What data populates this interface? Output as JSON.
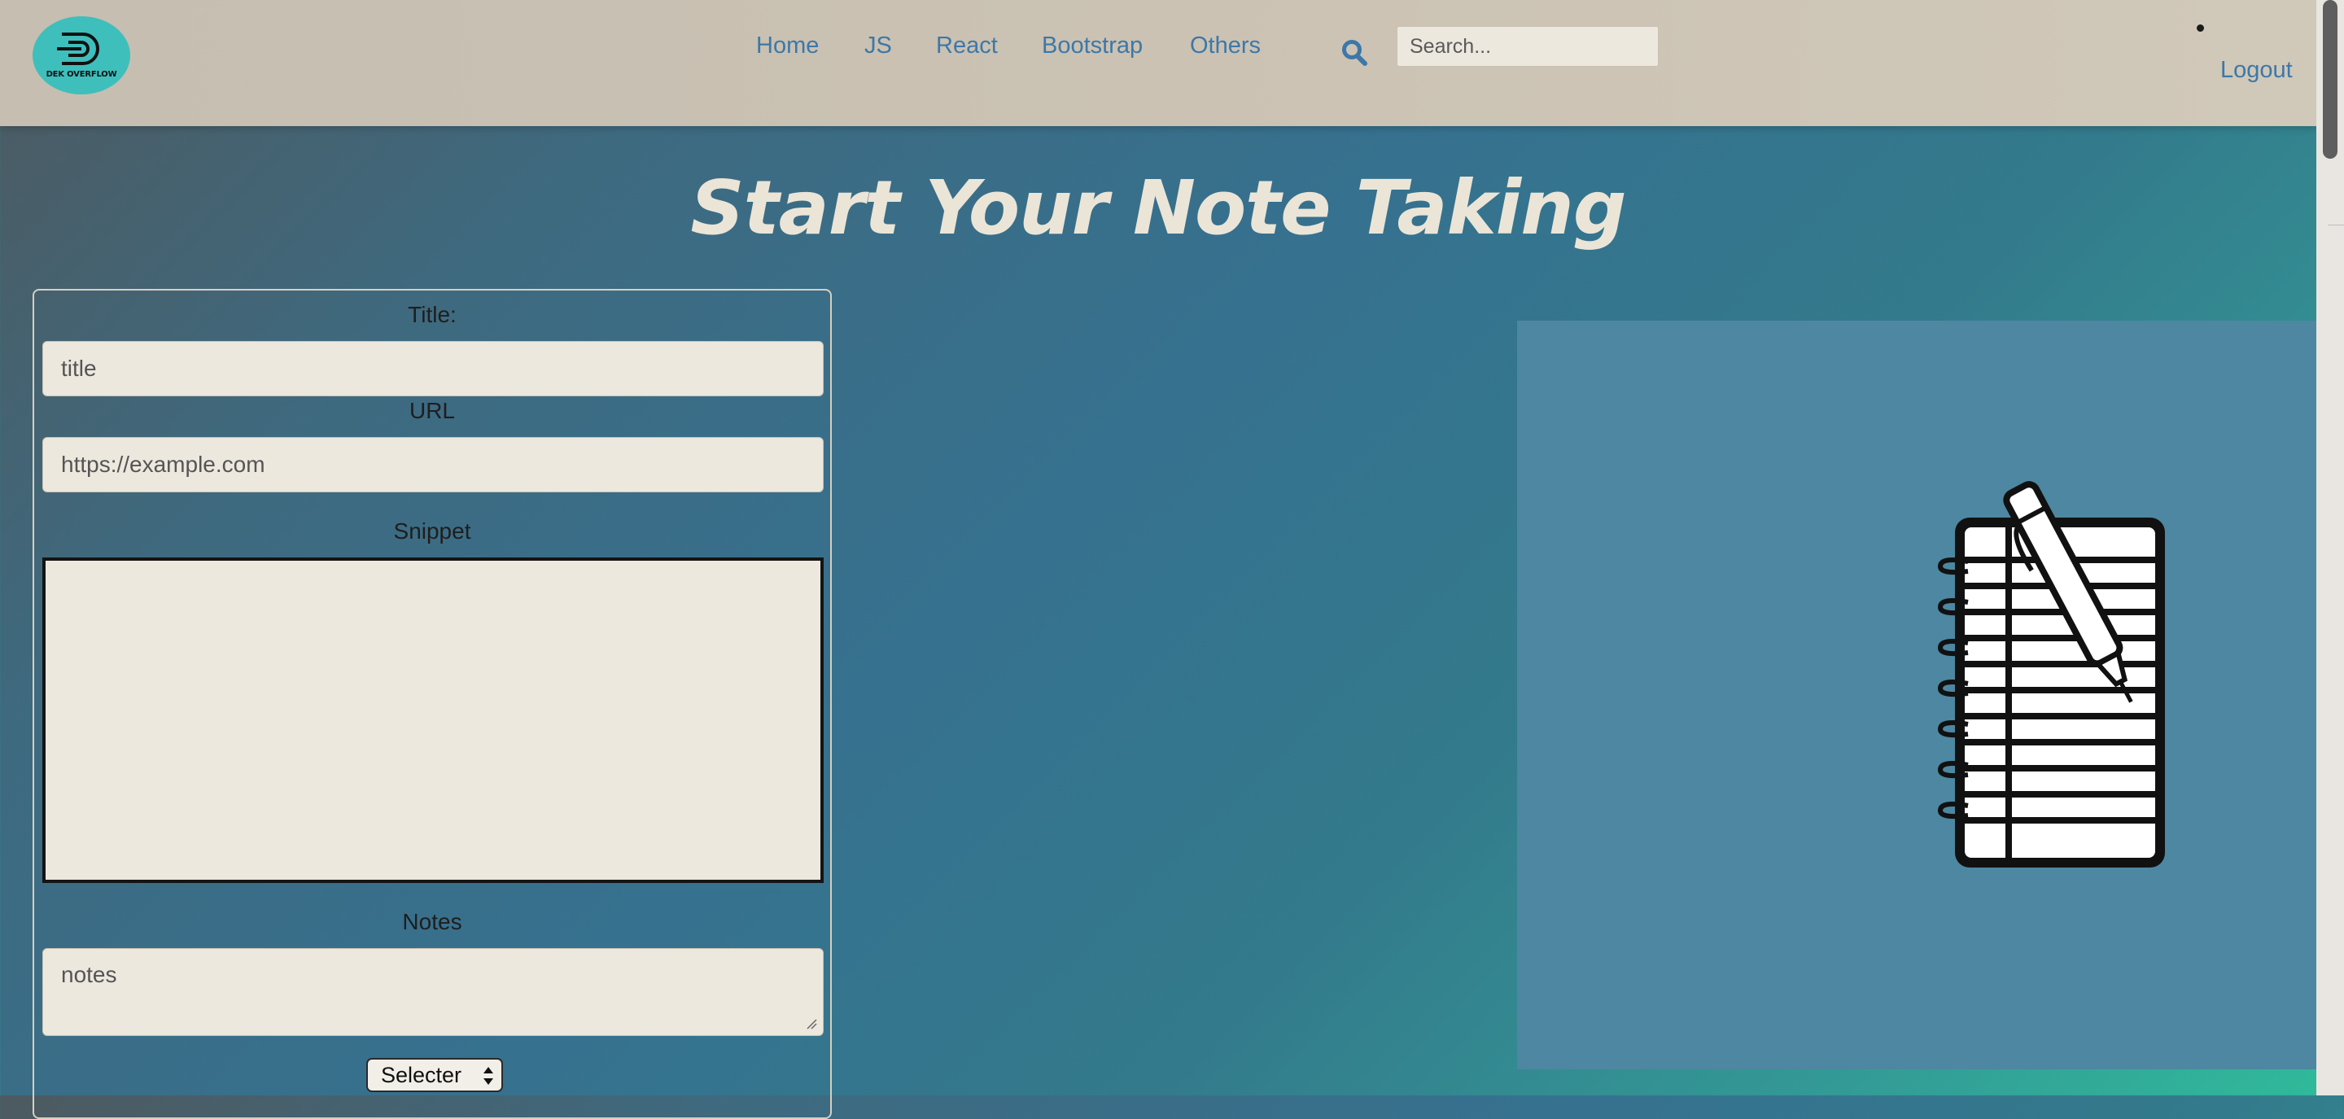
{
  "navbar": {
    "logo_text": "DEK OVERFLOW",
    "links": [
      "Home",
      "JS",
      "React",
      "Bootstrap",
      "Others"
    ],
    "search_placeholder": "Search...",
    "logout": "Logout",
    "link_color": "#3d78a8"
  },
  "hero": {
    "title": "Start Your Note Taking"
  },
  "form": {
    "title_label": "Title:",
    "title_placeholder": "title",
    "url_label": "URL",
    "url_placeholder": "https://example.com",
    "snippet_label": "Snippet",
    "notes_label": "Notes",
    "notes_placeholder": "notes",
    "select_value": "Selecter"
  },
  "illustration": {
    "icon": "notebook-with-pen-icon",
    "panel_color": "#4d87a1"
  }
}
